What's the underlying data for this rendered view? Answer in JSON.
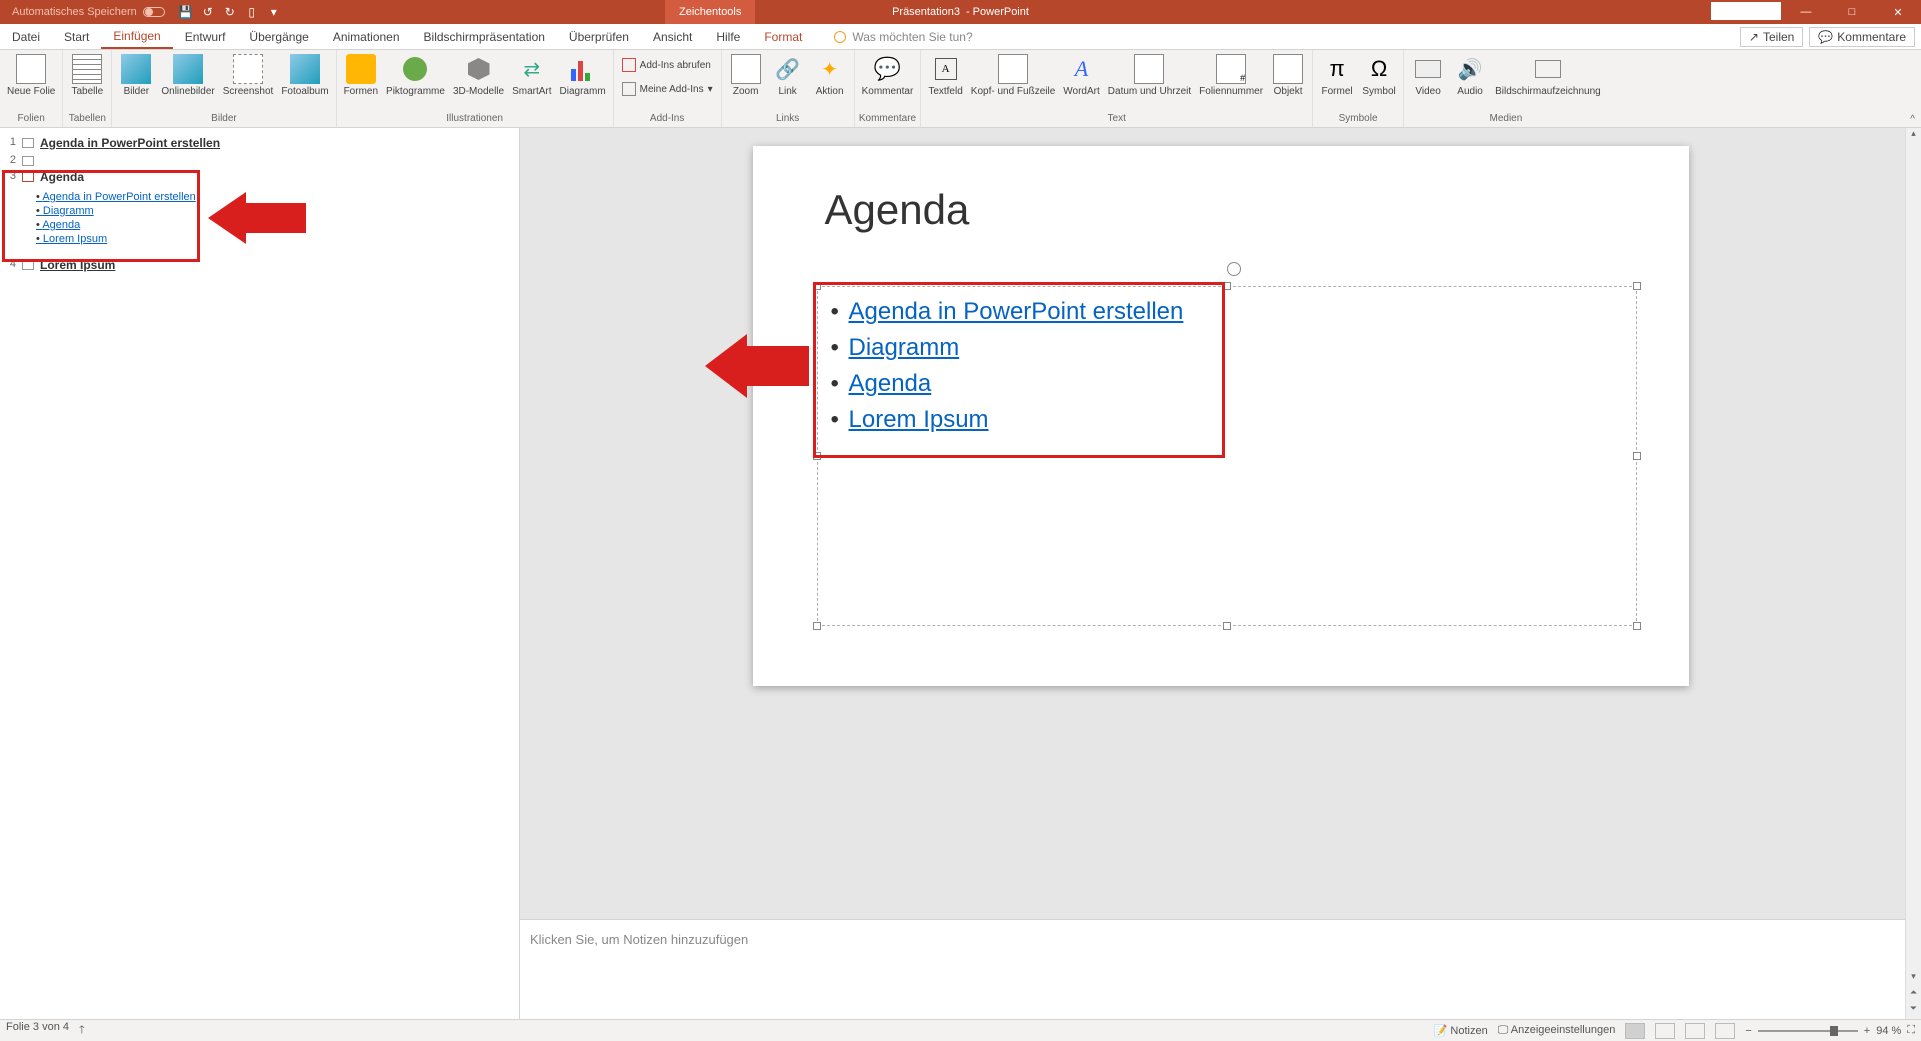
{
  "titlebar": {
    "autosave_label": "Automatisches Speichern",
    "title_doc": "Präsentation3",
    "title_app": "- PowerPoint",
    "context_tool": "Zeichentools"
  },
  "tabs": {
    "datei": "Datei",
    "start": "Start",
    "einfuegen": "Einfügen",
    "entwurf": "Entwurf",
    "uebergaenge": "Übergänge",
    "animationen": "Animationen",
    "bildschirm": "Bildschirmpräsentation",
    "ueberpruefen": "Überprüfen",
    "ansicht": "Ansicht",
    "hilfe": "Hilfe",
    "format": "Format",
    "tellme": "Was möchten Sie tun?",
    "teilen": "Teilen",
    "kommentare": "Kommentare"
  },
  "ribbon": {
    "groupFolien": "Folien",
    "groupTabellen": "Tabellen",
    "groupBilder": "Bilder",
    "groupIllustrationen": "Illustrationen",
    "groupAddins": "Add-Ins",
    "groupLinks": "Links",
    "groupKommentare": "Kommentare",
    "groupText": "Text",
    "groupSymbole": "Symbole",
    "groupMedien": "Medien",
    "neueFolie": "Neue Folie",
    "tabelle": "Tabelle",
    "bilder": "Bilder",
    "onlinebilder": "Onlinebilder",
    "screenshot": "Screenshot",
    "fotoalbum": "Fotoalbum",
    "formen": "Formen",
    "piktogramme": "Piktogramme",
    "modelle3d": "3D-Modelle",
    "smartart": "SmartArt",
    "diagramm": "Diagramm",
    "addinsAbrufen": "Add-Ins abrufen",
    "meineAddins": "Meine Add-Ins",
    "zoom": "Zoom",
    "link": "Link",
    "aktion": "Aktion",
    "kommentar": "Kommentar",
    "textfeld": "Textfeld",
    "kopfFuss": "Kopf- und Fußzeile",
    "wordart": "WordArt",
    "datumUhrzeit": "Datum und Uhrzeit",
    "foliennummer": "Foliennummer",
    "objekt": "Objekt",
    "formel": "Formel",
    "symbol": "Symbol",
    "video": "Video",
    "audio": "Audio",
    "bildschirmaufz": "Bildschirmaufzeichnung"
  },
  "outline": {
    "s1": "Agenda in PowerPoint erstellen",
    "s3_title": "Agenda",
    "s3_b1": "Agenda in PowerPoint erstellen",
    "s3_b2": "Diagramm",
    "s3_b3": "Agenda",
    "s3_b4": "Lorem Ipsum",
    "s4": "Lorem Ipsum"
  },
  "slide": {
    "title": "Agenda",
    "b1": "Agenda in PowerPoint erstellen",
    "b2": "Diagramm",
    "b3": "Agenda",
    "b4": "Lorem Ipsum"
  },
  "notes": {
    "placeholder": "Klicken Sie, um Notizen hinzuzufügen"
  },
  "status": {
    "folie": "Folie 3 von 4",
    "lang": "",
    "notizen": "Notizen",
    "anzeige": "Anzeigeeinstellungen",
    "zoom": "94 %"
  }
}
